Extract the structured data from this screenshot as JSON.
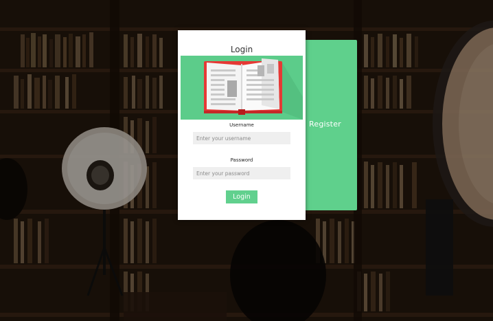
{
  "register_tab": {
    "label": "Register"
  },
  "login_card": {
    "title": "Login",
    "username": {
      "label": "Username",
      "placeholder": "Enter your username",
      "value": ""
    },
    "password": {
      "label": "Password",
      "placeholder": "Enter your password",
      "value": ""
    },
    "submit_label": "Login"
  },
  "hero_image": {
    "icon": "open-book-icon"
  },
  "colors": {
    "accent": "#5fd08c",
    "card": "#ffffff",
    "input_bg": "#efefef",
    "book_red": "#e53935"
  }
}
